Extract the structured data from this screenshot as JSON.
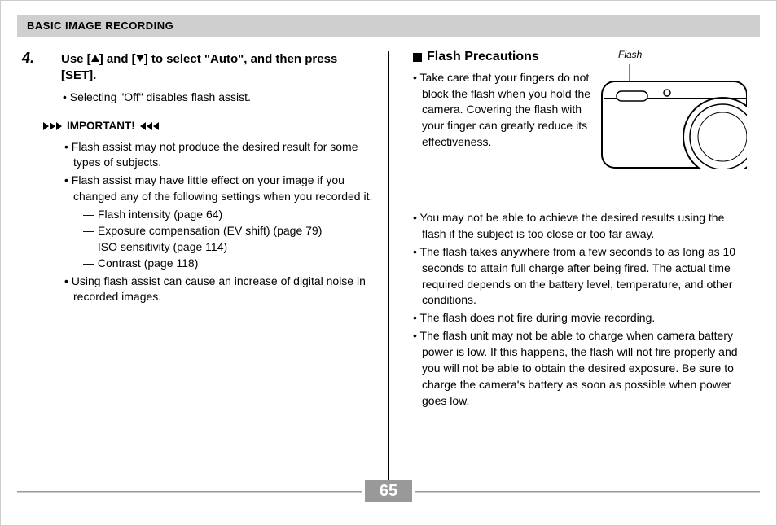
{
  "header": "BASIC IMAGE RECORDING",
  "left": {
    "step_num": "4.",
    "step_pre": "Use [",
    "step_mid": "] and [",
    "step_post": "] to select \"Auto\", and then press [SET].",
    "off_note": "• Selecting \"Off\" disables flash assist.",
    "important": "IMPORTANT!",
    "imp1": "• Flash assist may not produce the desired result for some types of subjects.",
    "imp2": "• Flash assist may have little effect on your image if you changed any of the following settings when you recorded it.",
    "d1": "—  Flash intensity (page 64)",
    "d2": "—  Exposure compensation (EV shift) (page 79)",
    "d3": "—  ISO sensitivity (page 114)",
    "d4": "—  Contrast (page 118)",
    "imp3": "• Using flash assist can cause an increase of digital noise in recorded images."
  },
  "right": {
    "heading": "Flash Precautions",
    "flash_label": "Flash",
    "p1": "• Take care that your fingers do not block the flash when you hold the camera. Covering the flash with your finger can greatly reduce its effectiveness.",
    "b1": "• You may not be able to achieve the desired results using the flash if the subject is too close or too far away.",
    "b2": "• The flash takes anywhere from a few seconds to as long as 10 seconds to attain full charge after being fired. The actual time required depends on the battery level, temperature, and other conditions.",
    "b3": "• The flash does not fire during movie recording.",
    "b4": "• The flash unit may not be able to charge when camera battery power is low. If this happens, the flash will not fire properly and you will not be able to obtain the desired exposure. Be sure to charge the camera's battery as soon as possible when power goes low."
  },
  "page": "65"
}
